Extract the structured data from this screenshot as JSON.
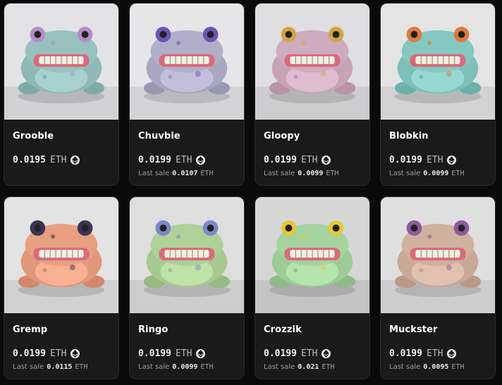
{
  "items": [
    {
      "name": "Grooble",
      "price": "0.0195",
      "currency": "ETH",
      "last_sale_label": "",
      "last_sale_value": "",
      "last_sale_currency": "",
      "bg": "#e3e3e6",
      "body": "#8fb9b6",
      "accent": "#b58bc9"
    },
    {
      "name": "Chuvbie",
      "price": "0.0199",
      "currency": "ETH",
      "last_sale_label": "Last sale",
      "last_sale_value": "0.0107",
      "last_sale_currency": "ETH",
      "bg": "#e6e6e8",
      "body": "#a9a6c1",
      "accent": "#6e53b6"
    },
    {
      "name": "Gloopy",
      "price": "0.0199",
      "currency": "ETH",
      "last_sale_label": "Last sale",
      "last_sale_value": "0.0099",
      "last_sale_currency": "ETH",
      "bg": "#dfdfe1",
      "body": "#c7a3b8",
      "accent": "#d1a545"
    },
    {
      "name": "Blobkin",
      "price": "0.0199",
      "currency": "ETH",
      "last_sale_label": "Last sale",
      "last_sale_value": "0.0099",
      "last_sale_currency": "ETH",
      "bg": "#e4e4e4",
      "body": "#7cc0b9",
      "accent": "#e07a3c"
    },
    {
      "name": "Gremp",
      "price": "0.0199",
      "currency": "ETH",
      "last_sale_label": "Last sale",
      "last_sale_value": "0.0115",
      "last_sale_currency": "ETH",
      "bg": "#e3e3e3",
      "body": "#e19779",
      "accent": "#3b3552"
    },
    {
      "name": "Ringo",
      "price": "0.0199",
      "currency": "ETH",
      "last_sale_label": "Last sale",
      "last_sale_value": "0.0099",
      "last_sale_currency": "ETH",
      "bg": "#dededf",
      "body": "#a6c98f",
      "accent": "#7a88c8"
    },
    {
      "name": "Crozzik",
      "price": "0.0199",
      "currency": "ETH",
      "last_sale_label": "Last sale",
      "last_sale_value": "0.021",
      "last_sale_currency": "ETH",
      "bg": "#d6d6d6",
      "body": "#9ccb95",
      "accent": "#e8c636"
    },
    {
      "name": "Muckster",
      "price": "0.0199",
      "currency": "ETH",
      "last_sale_label": "Last sale",
      "last_sale_value": "0.0095",
      "last_sale_currency": "ETH",
      "bg": "#e0dfe0",
      "body": "#c8a896",
      "accent": "#8e5a9c"
    }
  ]
}
